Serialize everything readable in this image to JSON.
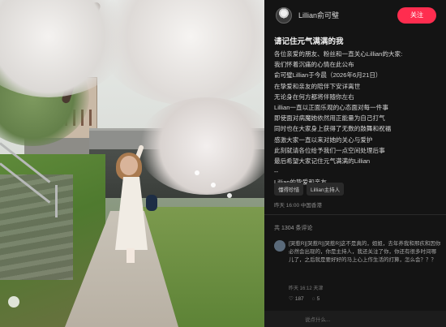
{
  "author": {
    "name": "Lillian俞可璧",
    "follow_label": "关注"
  },
  "note": {
    "title": "请记住元气满满的我",
    "lines": [
      "各位亲爱的朋友、粉丝和一直关心Lillian的大家:",
      "我们怀着沉痛的心情在此公布",
      "俞可璧Lillian于今晨（2026年6月21日）",
      "在挚爱和亲友的陪伴下安详离世",
      "无论身在何方都将伴随你左右",
      "Lillian一直以正面乐观的心态面对每一件事",
      "即使面对病魔她依然用正能量为自己打气",
      "同时也在大家身上获得了无数的鼓舞和祝福",
      "感激大家一直以来对她的关心与爱护",
      "此刻就请各位给予我们一点空间处理后事",
      "最后希望大家记住元气满满的Lillian",
      "--",
      "Lillian的挚爱和亲友"
    ],
    "tags": [
      "懂得珍惜",
      "Lillian主持人"
    ],
    "meta": "昨天 16:00 中国香港"
  },
  "comments": {
    "count_label": "共 1304 条评论",
    "items": [
      {
        "text": "[哭惹R][哭惹R][哭惹R]这不是真的，姐姐，去年养我和邢疚和因你必然会出现的，你是主持人，我还关注了你，你还有很多时间哪儿了，之后就是要好好的马上心上作生活的打算，怎么会？？？",
        "meta": "昨天 16:12 天津",
        "likes": "187",
        "replies": "5"
      }
    ]
  },
  "input_bar": {
    "placeholder": "说点什么..."
  },
  "colors": {
    "accent": "#ff2d4f",
    "panel_bg": "#141414"
  }
}
